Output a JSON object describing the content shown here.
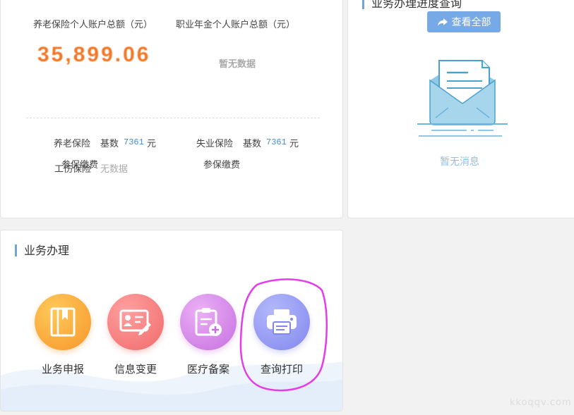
{
  "account": {
    "pension_total_label": "养老保险个人账户总额（元）",
    "pension_total_value": "35,899.06",
    "annuity_total_label": "职业年金个人账户总额（元）",
    "annuity_no_data": "暂无数据",
    "rows": [
      {
        "name": "养老保险",
        "base_label": "基数",
        "base_value": "7361",
        "unit": "元",
        "status": "参保缴费"
      },
      {
        "name": "失业保险",
        "base_label": "基数",
        "base_value": "7361",
        "unit": "元",
        "status": "参保缴费"
      },
      {
        "name": "工伤保险",
        "status": "无数据"
      }
    ]
  },
  "progress": {
    "title": "业务办理进度查询",
    "view_all_label": "查看全部",
    "empty_label": "暂无消息"
  },
  "business": {
    "title": "业务办理",
    "items": [
      {
        "label": "业务申报",
        "icon": "book-icon",
        "color": "#f7962a"
      },
      {
        "label": "信息变更",
        "icon": "id-card-edit-icon",
        "color": "#f06a6a"
      },
      {
        "label": "医疗备案",
        "icon": "clipboard-plus-icon",
        "color": "#c66fe0"
      },
      {
        "label": "查询打印",
        "icon": "printer-icon",
        "color": "#8287ee"
      }
    ]
  },
  "watermark": "kkoqqv.com"
}
